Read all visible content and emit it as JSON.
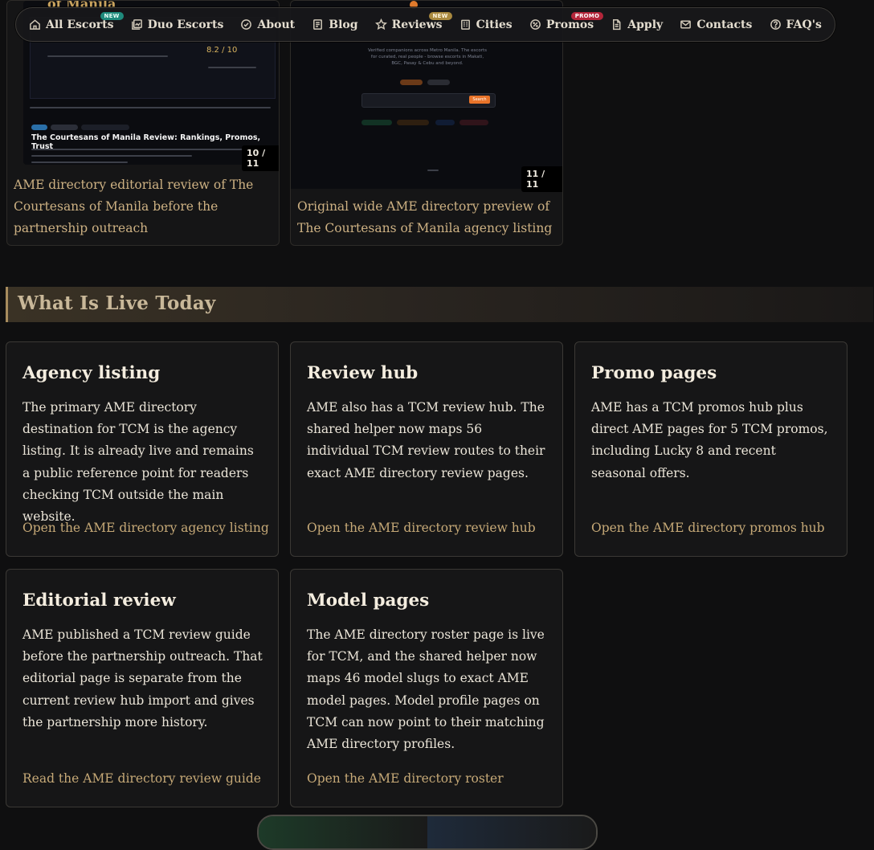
{
  "nav": {
    "items": [
      {
        "label": "All Escorts",
        "badge": "NEW",
        "icon": "home-icon"
      },
      {
        "label": "Duo Escorts",
        "icon": "duo-icon"
      },
      {
        "label": "About",
        "icon": "check-circle-icon"
      },
      {
        "label": "Blog",
        "icon": "document-icon"
      },
      {
        "label": "Reviews",
        "badge": "NEW",
        "icon": "star-icon"
      },
      {
        "label": "Cities",
        "icon": "building-icon"
      },
      {
        "label": "Promos",
        "badge": "PROMO",
        "icon": "tag-icon"
      },
      {
        "label": "Apply",
        "icon": "form-icon"
      },
      {
        "label": "Contacts",
        "icon": "mail-icon"
      },
      {
        "label": "FAQ's",
        "icon": "question-icon"
      }
    ]
  },
  "gallery": [
    {
      "counter": "10 / 11",
      "caption": "AME directory editorial review of The Courtesans of Manila before the partnership outreach",
      "shot_title": "The Courtesans of Manila Review: Rankings, Promos, Trust",
      "shot_heading": "of Manila",
      "shot_score": "8.2 / 10"
    },
    {
      "counter": "11 / 11",
      "caption": "Original wide AME directory preview of The Courtesans of Manila agency listing",
      "shot_text": "Verified companions across Metro Manila. The escorts for curated, real people - browse escorts in Makati, BGC, Pasay & Cebu and beyond.",
      "shot_button": "Search"
    }
  ],
  "section": {
    "title": "What Is Live Today"
  },
  "cards": [
    {
      "title": "Agency listing",
      "body": "The primary AME directory destination for TCM is the agency listing. It is already live and remains a public reference point for readers checking TCM outside the main website.",
      "link": "Open the AME directory agency listing"
    },
    {
      "title": "Review hub",
      "body": "AME also has a TCM review hub. The shared helper now maps 56 individual TCM review routes to their exact AME directory review pages.",
      "link": "Open the AME directory review hub"
    },
    {
      "title": "Promo pages",
      "body": "AME has a TCM promos hub plus direct AME pages for 5 TCM promos, including Lucky 8 and recent seasonal offers.",
      "link": "Open the AME directory promos hub"
    },
    {
      "title": "Editorial review",
      "body": "AME published a TCM review guide before the partnership outreach. That editorial page is separate from the current review hub import and gives the partnership more history.",
      "link": "Read the AME directory review guide"
    },
    {
      "title": "Model pages",
      "body": "The AME directory roster page is live for TCM, and the shared helper now maps 46 model slugs to exact AME model pages. Model profile pages on TCM can now point to their matching AME directory profiles.",
      "link": "Open the AME directory roster"
    }
  ]
}
